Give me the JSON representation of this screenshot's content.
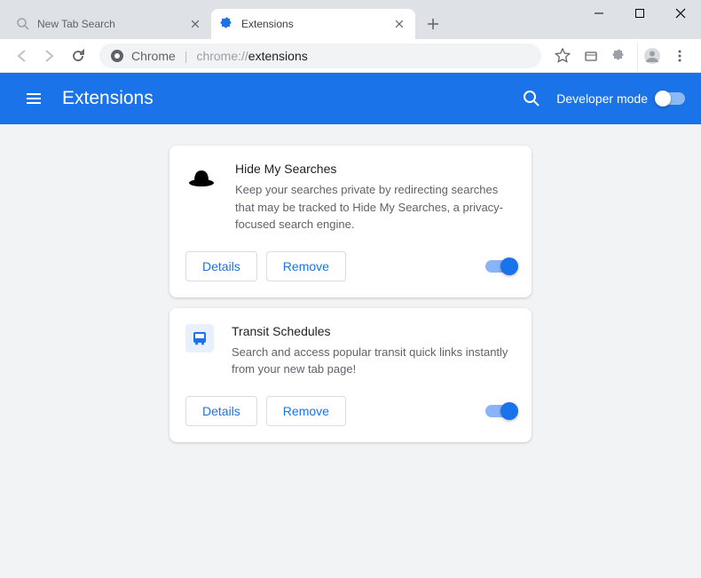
{
  "window": {
    "tabs": [
      {
        "title": "New Tab Search",
        "active": false,
        "icon": "search"
      },
      {
        "title": "Extensions",
        "active": true,
        "icon": "puzzle"
      }
    ]
  },
  "toolbar": {
    "chrome_label": "Chrome",
    "url_scheme": "chrome://",
    "url_path": "extensions"
  },
  "header": {
    "title": "Extensions",
    "dev_mode_label": "Developer mode"
  },
  "buttons": {
    "details": "Details",
    "remove": "Remove"
  },
  "extensions": [
    {
      "name": "Hide My Searches",
      "description": "Keep your searches private by redirecting searches that may be tracked to Hide My Searches, a privacy-focused search engine.",
      "icon": "hat",
      "enabled": true
    },
    {
      "name": "Transit Schedules",
      "description": "Search and access popular transit quick links instantly from your new tab page!",
      "icon": "transit",
      "enabled": true
    }
  ]
}
